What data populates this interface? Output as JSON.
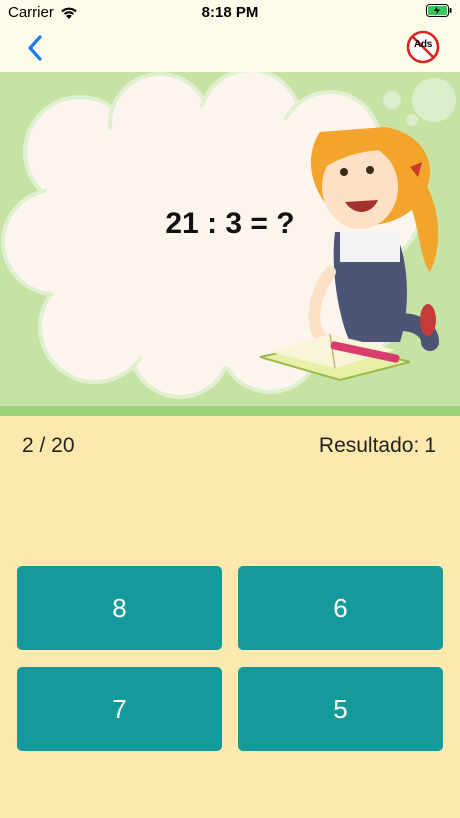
{
  "status_bar": {
    "carrier": "Carrier",
    "time": "8:18 PM"
  },
  "nav": {
    "back_icon": "chevron-left-icon",
    "no_ads_label": "Ads"
  },
  "quiz": {
    "question": "21 : 3 = ?",
    "progress": "2 / 20",
    "score_label": "Resultado:",
    "score_value": "1",
    "answers": [
      "8",
      "6",
      "7",
      "5"
    ]
  },
  "colors": {
    "background": "#fde9ae",
    "header_bg": "#fffbea",
    "hero_bg": "#c6e3a4",
    "answer_button": "#159a9c",
    "back_icon": "#1e7cf2",
    "no_ads_circle": "#d9261c"
  }
}
